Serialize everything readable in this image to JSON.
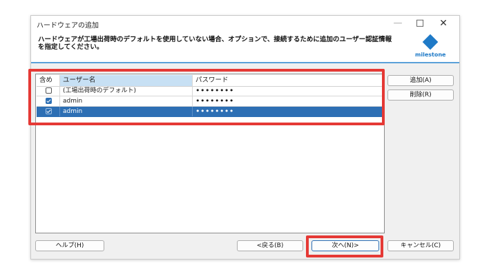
{
  "window": {
    "title": "ハードウェアの追加",
    "minimize_glyph": "—",
    "maximize_glyph": "□",
    "close_glyph": "✕"
  },
  "header": {
    "instruction": "ハードウェアが工場出荷時のデフォルトを使用していない場合、オプションで、接続するために追加のユーザー認証情報を指定してください。",
    "logo_text": "milestone",
    "logo_color": "#1f7ac7"
  },
  "table": {
    "columns": {
      "include": "含め",
      "username": "ユーザー名",
      "password": "パスワード"
    },
    "rows": [
      {
        "checked": false,
        "username": "(工場出荷時のデフォルト)",
        "password": "••••••••",
        "selected": false
      },
      {
        "checked": true,
        "username": "admin",
        "password": "••••••••",
        "selected": false
      },
      {
        "checked": true,
        "username": "admin",
        "password": "••••••••",
        "selected": true
      }
    ]
  },
  "side_buttons": {
    "add": "追加(A)",
    "delete": "削除(R)"
  },
  "footer_buttons": {
    "help": "ヘルプ(H)",
    "back": "<戻る(B)",
    "next": "次へ(N)>",
    "cancel": "キャンセル(C)"
  },
  "colors": {
    "highlight": "#e53935",
    "selection": "#2d6fb4"
  }
}
